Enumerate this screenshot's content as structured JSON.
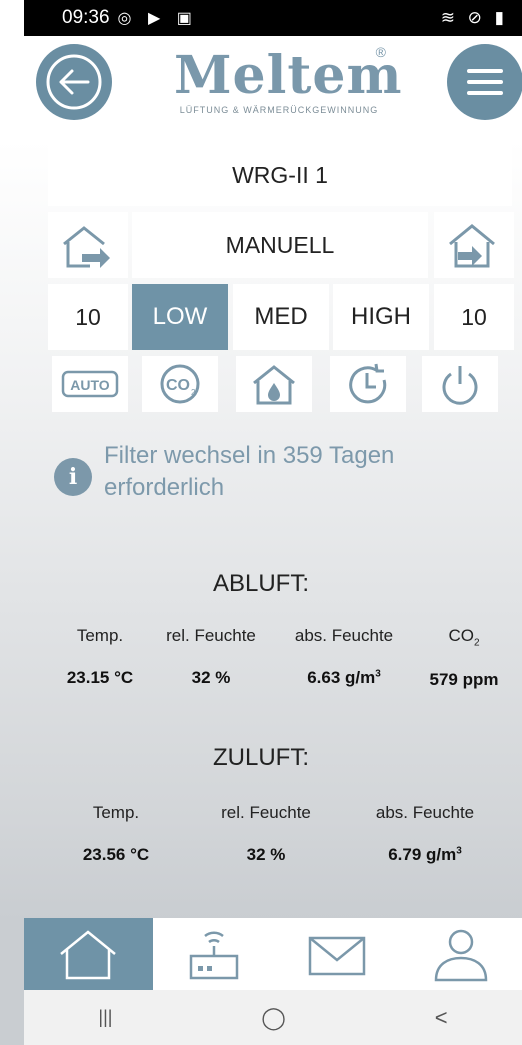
{
  "status_bar": {
    "time": "09:36",
    "left_icons": "◎ ▶ ▣",
    "right_icons": "≋ ⊘ ▮"
  },
  "header": {
    "back_icon": "arrow-left-icon",
    "menu_icon": "menu-icon",
    "logo_text": "Meltem",
    "logo_reg": "®",
    "logo_tagline": "LÜFTUNG & WÄRMERÜCKGEWINNUNG"
  },
  "device": {
    "name": "WRG-II 1",
    "mode": "MANUELL",
    "exhaust_value": "10",
    "supply_value": "10"
  },
  "levels": {
    "low": "LOW",
    "med": "MED",
    "high": "HIGH",
    "selected": "LOW"
  },
  "modes": {
    "auto": "AUTO",
    "co2": "CO2",
    "humidity": "humidity-house-icon",
    "timer": "timer-icon",
    "power": "power-icon"
  },
  "info": {
    "text": "Filter wechsel in 359 Tagen erforderlich"
  },
  "abluft": {
    "title": "ABLUFT:",
    "headers": {
      "temp": "Temp.",
      "rel": "rel. Feuchte",
      "abs": "abs. Feuchte",
      "co2": "CO",
      "co2_sub": "2"
    },
    "values": {
      "temp": "23.15 °C",
      "rel": "32 %",
      "abs": "6.63 g/m",
      "abs_sup": "3",
      "co2": "579 ppm"
    }
  },
  "zuluft": {
    "title": "ZULUFT:",
    "headers": {
      "temp": "Temp.",
      "rel": "rel. Feuchte",
      "abs": "abs. Feuchte"
    },
    "values": {
      "temp": "23.56 °C",
      "rel": "32 %",
      "abs": "6.79 g/m",
      "abs_sup": "3"
    }
  },
  "tabs": [
    "home-icon",
    "router-icon",
    "mail-icon",
    "user-icon"
  ],
  "navbar": {
    "recent": "|||",
    "home": "◯",
    "back": "<"
  },
  "colors": {
    "accent": "#6f93a7",
    "accent_light": "#7d99ab"
  }
}
